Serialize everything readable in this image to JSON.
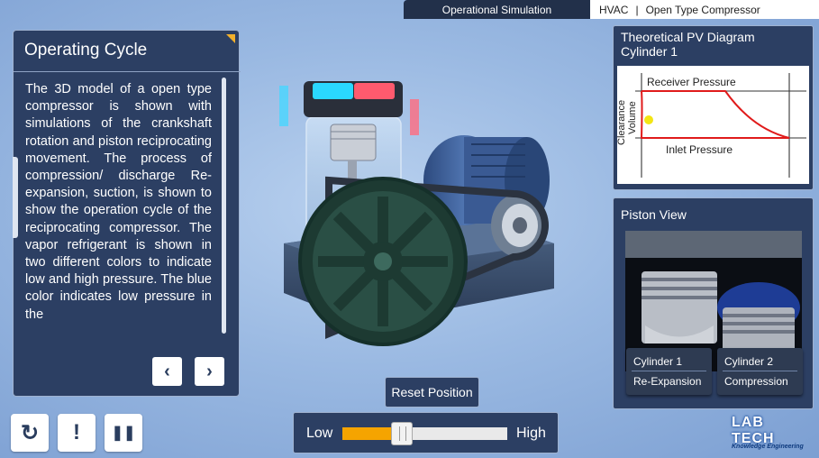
{
  "topbar": {
    "mode": "Operational Simulation",
    "crumb_1": "HVAC",
    "separator": "|",
    "crumb_2": "Open Type Compressor"
  },
  "left_panel": {
    "title": "Operating Cycle",
    "text": "The 3D model of a open type compressor is shown with simulations of the crankshaft rotation and piston reciprocating movement. The process of compression/ discharge Re-expansion, suction, is shown to show the operation cycle of the reciprocating compressor. The vapor refrigerant is shown in two different colors to indicate low and high pressure. The blue color indicates low pressure in the",
    "prev_label": "‹",
    "next_label": "›"
  },
  "controls": {
    "restart_icon": "↻",
    "info_icon": "!",
    "pause_icon": "❚❚"
  },
  "reset_button": "Reset Position",
  "speed": {
    "low_label": "Low",
    "high_label": "High",
    "value_fraction": 0.34,
    "fill_color": "#f5a400"
  },
  "pv_panel": {
    "title_line1": "Theoretical PV Diagram",
    "title_line2": "Cylinder 1",
    "receiver_label": "Receiver Pressure",
    "inlet_label": "Inlet Pressure",
    "axis_label_1": "Clearance",
    "axis_label_2": "Volume",
    "curve_color": "#e01b1b",
    "marker_color": "#f3e514"
  },
  "piston_panel": {
    "title": "Piston View",
    "cylinder_1": {
      "name": "Cylinder 1",
      "state": "Re-Expansion"
    },
    "cylinder_2": {
      "name": "Cylinder 2",
      "state": "Compression"
    }
  },
  "logo": {
    "text": "LAB TECH",
    "tagline": "Knowledge Engineering"
  },
  "colors": {
    "panel_bg": "#2c3f63",
    "background": "#9ab9e2",
    "accent": "#f2b02c"
  }
}
